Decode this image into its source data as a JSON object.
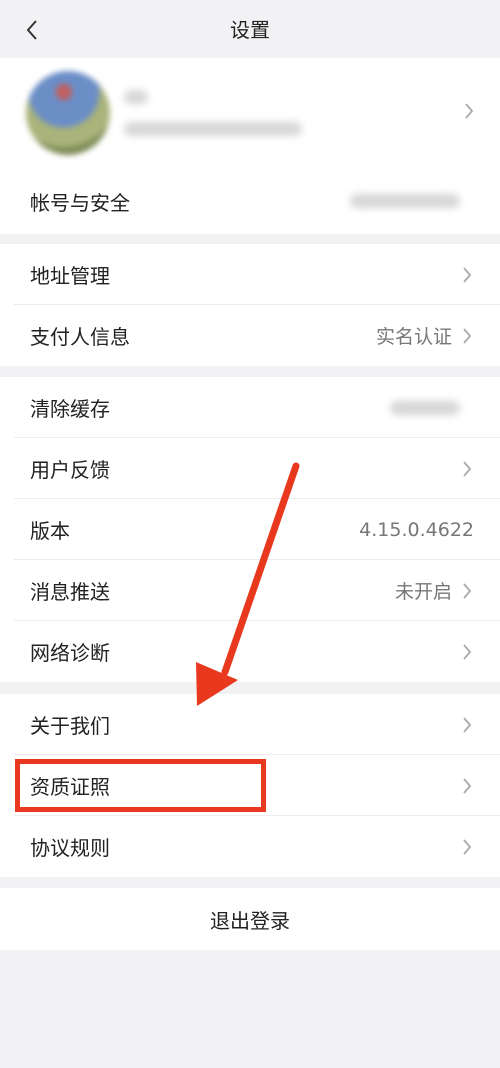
{
  "header": {
    "title": "设置"
  },
  "account": {
    "row_label": "帐号与安全"
  },
  "group2": [
    {
      "label": "地址管理",
      "value": ""
    },
    {
      "label": "支付人信息",
      "value": "实名认证"
    }
  ],
  "group3": [
    {
      "label": "清除缓存",
      "value": ""
    },
    {
      "label": "用户反馈",
      "value": ""
    },
    {
      "label": "版本",
      "value": "4.15.0.4622"
    },
    {
      "label": "消息推送",
      "value": "未开启"
    },
    {
      "label": "网络诊断",
      "value": ""
    }
  ],
  "group4": [
    {
      "label": "关于我们"
    },
    {
      "label": "资质证照"
    },
    {
      "label": "协议规则"
    }
  ],
  "logout": {
    "label": "退出登录"
  },
  "colors": {
    "accent_red": "#e8391f",
    "background": "#f2f2f4"
  }
}
